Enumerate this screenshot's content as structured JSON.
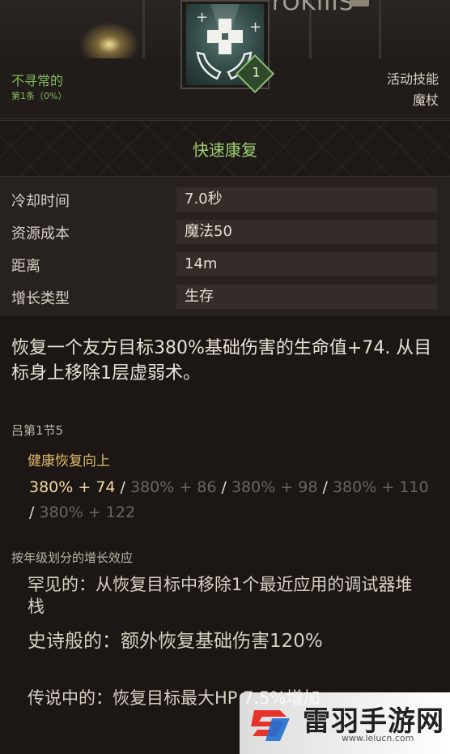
{
  "banner": {
    "partial_title": "rOKIIIS"
  },
  "skill_icon": {
    "icon": "healing-hands-cross-icon",
    "level": "1"
  },
  "header": {
    "rarity": "不寻常的",
    "rarity_sub": "第1条（0%）",
    "skill_type": "活动技能",
    "skill_class": "魔杖"
  },
  "skill_name": "快速康复",
  "stats": [
    {
      "label": "冷却时间",
      "value": "7.0秒"
    },
    {
      "label": "资源成本",
      "value": "魔法50"
    },
    {
      "label": "距离",
      "value": "14m"
    },
    {
      "label": "增长类型",
      "value": "生存"
    }
  ],
  "description": "恢复一个友方目标380%基础伤害的生命值+74. 从目标身上移除1层虚弱术。",
  "section1": {
    "title": "吕第1节5",
    "subtitle": "健康恢复向上",
    "tier_current": "380% + 74",
    "tiers": [
      "380% + 86",
      "380% + 98",
      "380% + 110",
      "380% + 122"
    ],
    "separator": " / "
  },
  "section2": {
    "title": "按年级划分的增长效应",
    "ranks": [
      "罕见的：从恢复目标中移除1个最近应用的调试器堆栈",
      "史诗般的：额外恢复基础伤害120%",
      "传说中的：恢复目标最大HP 7.5%增加"
    ]
  },
  "watermark": {
    "text": "雷羽手游网",
    "url": "www.leiucn.com"
  },
  "colors": {
    "rarity": "#7fbf5a",
    "skill_name": "#9ccf6e",
    "current_tier": "#f0d9a0",
    "subtitle": "#e0b96a"
  }
}
